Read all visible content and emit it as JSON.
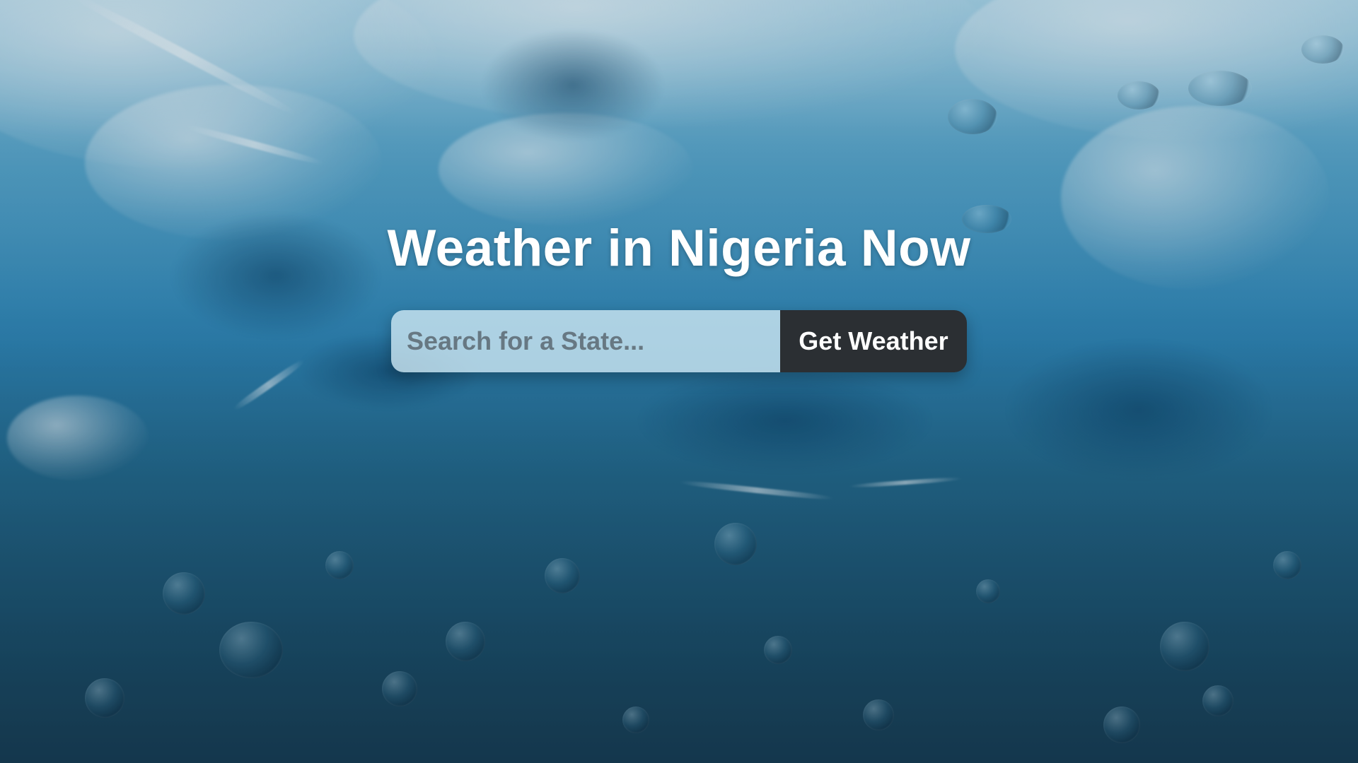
{
  "header": {
    "title": "Weather in Nigeria Now"
  },
  "search": {
    "placeholder": "Search for a State...",
    "value": "",
    "button_label": "Get Weather"
  },
  "theme": {
    "title_color": "#ffffff",
    "button_color": "#2b2f33",
    "button_text_color": "#ffffff",
    "background": "underwater ice image (blue tones)"
  }
}
